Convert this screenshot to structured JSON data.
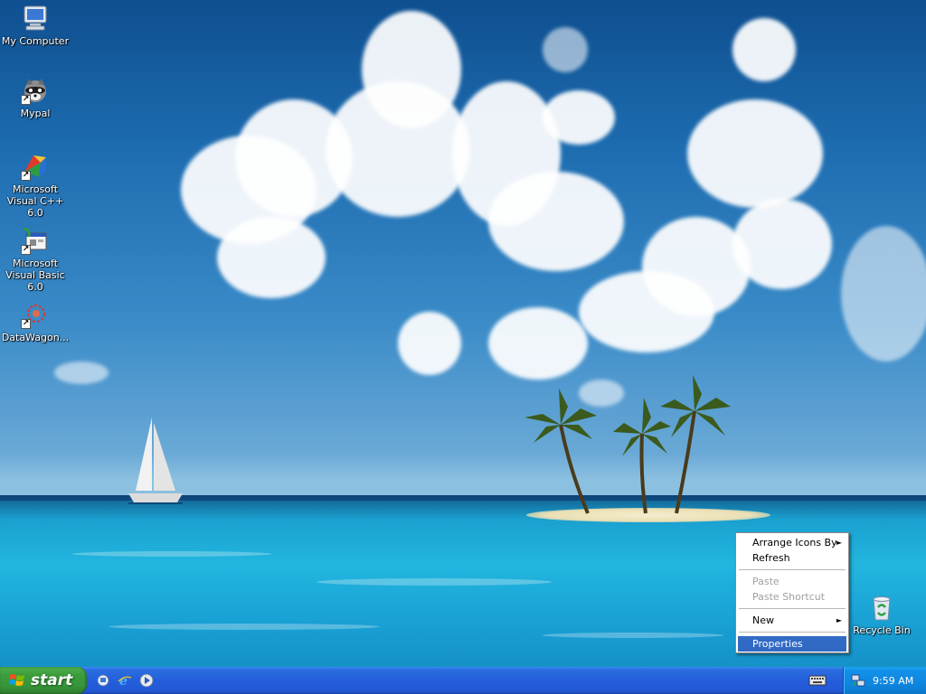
{
  "desktop": {
    "icons": [
      {
        "label": "My Computer",
        "icon": "my-computer-icon",
        "shortcut": false
      },
      {
        "label": "Mypal",
        "icon": "raccoon-icon",
        "shortcut": true
      },
      {
        "label": "Microsoft Visual C++ 6.0",
        "icon": "visual-cpp-icon",
        "shortcut": true
      },
      {
        "label": "Microsoft Visual Basic 6.0",
        "icon": "visual-basic-icon",
        "shortcut": true
      },
      {
        "label": "DataWagon...",
        "icon": "datawagon-icon",
        "shortcut": true
      }
    ],
    "recycle_bin": {
      "label": "Recycle Bin",
      "icon": "recycle-bin-icon"
    }
  },
  "context_menu": {
    "arrange_icons_by": "Arrange Icons By",
    "refresh": "Refresh",
    "paste": "Paste",
    "paste_shortcut": "Paste Shortcut",
    "new": "New",
    "properties": "Properties",
    "submenu_arrow": "►"
  },
  "taskbar": {
    "start_label": "start",
    "quick_launch": [
      "show-desktop-icon",
      "internet-explorer-icon",
      "media-player-icon"
    ],
    "clock": "9:59 AM"
  },
  "colors": {
    "taskbar_blue": "#245edb",
    "start_green": "#3c9c3c",
    "menu_highlight": "#316ac5",
    "tray_blue": "#0f87e0"
  }
}
